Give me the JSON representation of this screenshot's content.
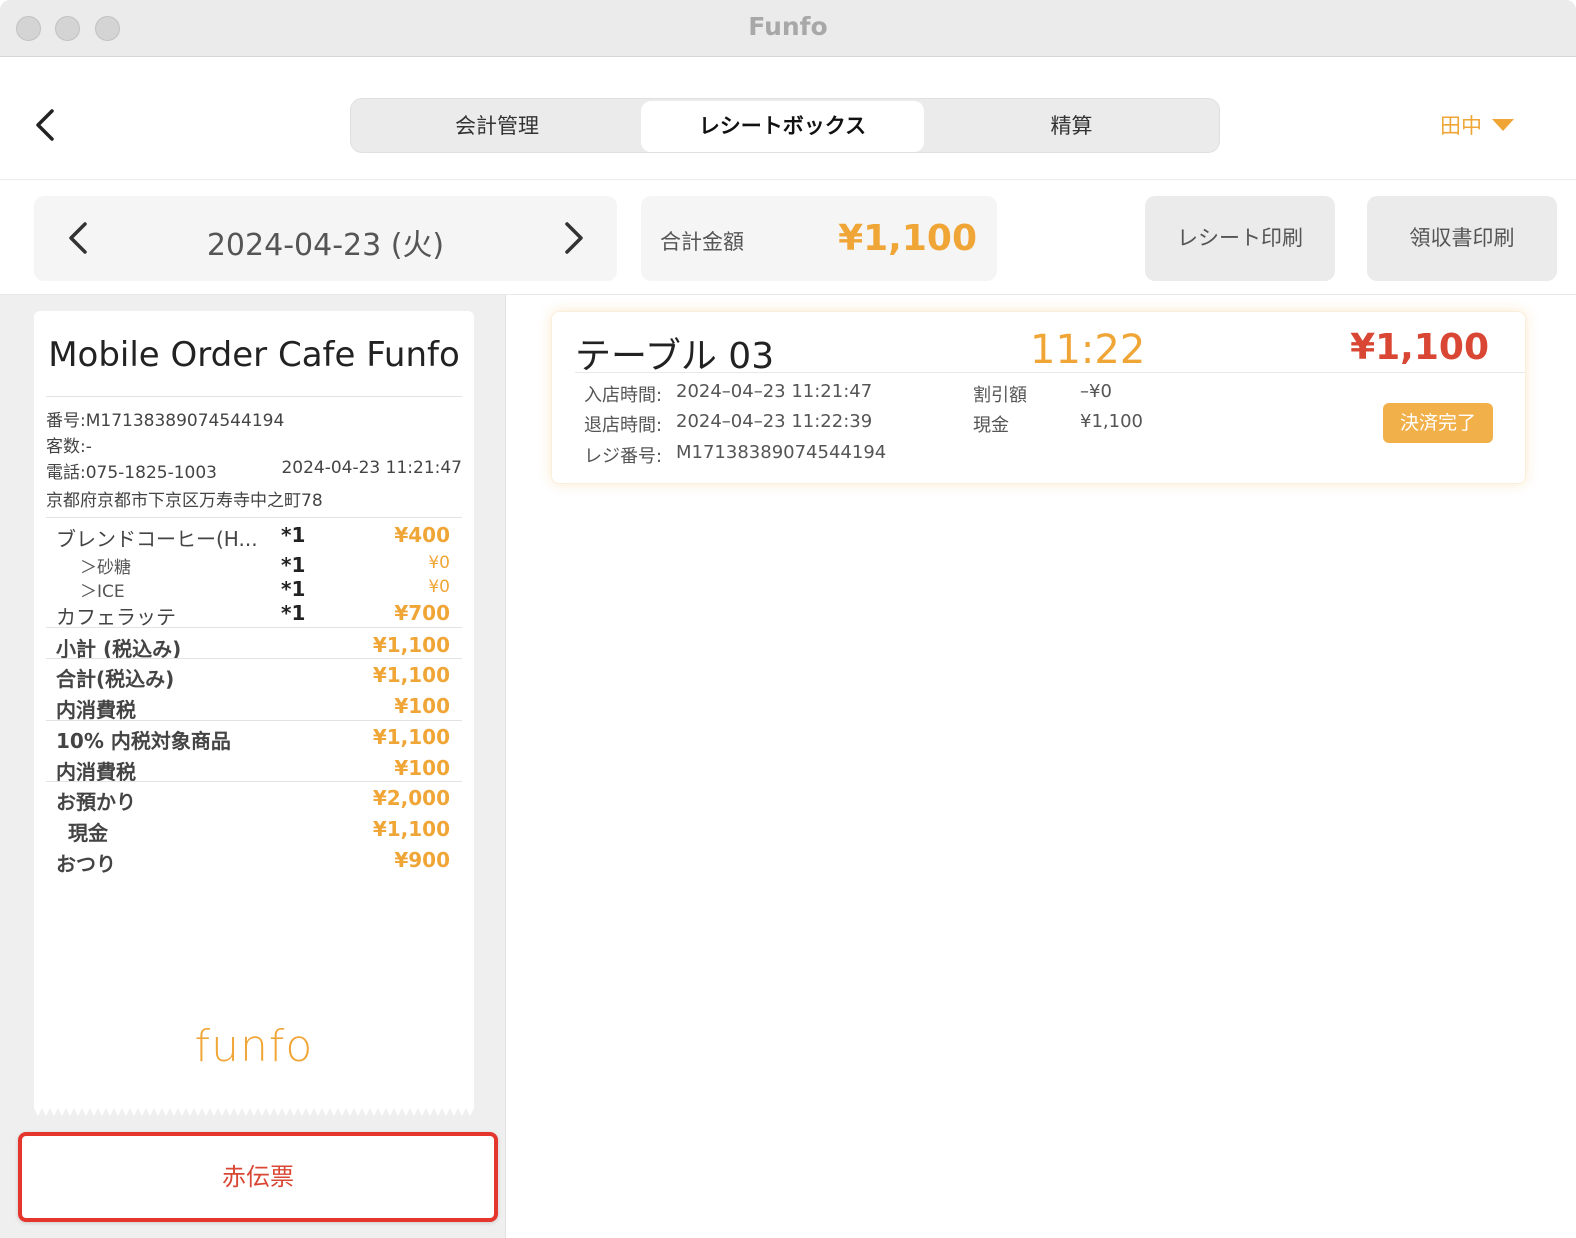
{
  "window": {
    "title": "Funfo"
  },
  "header": {
    "tabs": [
      {
        "label": "会計管理"
      },
      {
        "label": "レシートボックス"
      },
      {
        "label": "精算"
      }
    ],
    "user": "田中"
  },
  "toolbar": {
    "date": "2024-04-23 (火)",
    "total_label": "合計金額",
    "total_value": "¥1,100",
    "receipt_print": "レシート印刷",
    "invoice_print": "領収書印刷"
  },
  "receipt": {
    "shop_name": "Mobile Order Cafe Funfo",
    "number": "番号:M17138389074544194",
    "guests": "客数:-",
    "phone": "電話:075-1825-1003",
    "datetime": "2024-04-23 11:21:47",
    "address": "京都府京都市下京区万寿寺中之町78",
    "items": [
      {
        "name": "ブレンドコーヒー(H...",
        "qty": "*1",
        "price": "¥400"
      },
      {
        "name": "＞砂糖",
        "qty": "*1",
        "price": "¥0"
      },
      {
        "name": "＞ICE",
        "qty": "*1",
        "price": "¥0"
      },
      {
        "name": "カフェラッテ",
        "qty": "*1",
        "price": "¥700"
      }
    ],
    "summary": [
      {
        "label": "小計 (税込み)",
        "value": "¥1,100"
      },
      {
        "label": "合計(税込み)",
        "value": "¥1,100"
      },
      {
        "label": "内消費税",
        "value": "¥100"
      },
      {
        "label": "10% 内税対象商品",
        "value": "¥1,100"
      },
      {
        "label": "内消費税",
        "value": "¥100"
      },
      {
        "label": "お預かり",
        "value": "¥2,000"
      },
      {
        "label": "現金",
        "value": "¥1,100"
      },
      {
        "label": "おつり",
        "value": "¥900"
      }
    ],
    "logo": "funfo"
  },
  "red_slip_label": "赤伝票",
  "order": {
    "table": "テーブル 03",
    "time": "11:22",
    "amount": "¥1,100",
    "enter_label": "入店時間:",
    "enter_value": "2024–04–23 11:21:47",
    "exit_label": "退店時間:",
    "exit_value": "2024–04–23 11:22:39",
    "register_label": "レジ番号:",
    "register_value": "M17138389074544194",
    "discount_label": "割引額",
    "discount_value": "–¥0",
    "cash_label": "現金",
    "cash_value": "¥1,100",
    "status": "決済完了"
  },
  "colors": {
    "accent": "#f0a637",
    "red": "#d94734",
    "highlight_border": "#e5362e"
  }
}
